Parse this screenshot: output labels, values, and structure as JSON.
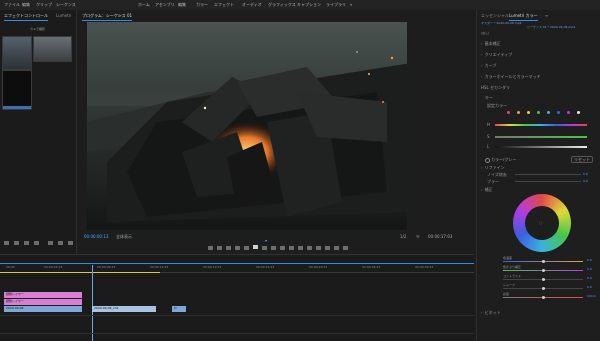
{
  "menubar": {
    "items": [
      "ファイル",
      "編集",
      "クリップ",
      "シーケンス",
      "マーカー",
      "グラフィック",
      "表示",
      "ウィンドウ",
      "ヘルプ",
      "ホーム",
      "アセンブリ",
      "編集",
      "カラー",
      "エフェクト",
      "オーディオ",
      "グラフィックス",
      "キャプション",
      "ライブラリ",
      "»"
    ]
  },
  "left_panel": {
    "tabs": [
      "エフェクトコントロール",
      "Lumetri"
    ],
    "clip_title": "カメラ撮影",
    "thumb_label": "00:00",
    "footer_icons": [
      "list-view-icon",
      "icon-view-icon",
      "freeform-icon",
      "zoom-icon",
      "bin-icon",
      "new-item-icon",
      "trash-icon"
    ]
  },
  "program": {
    "title": "プログラム：シーケンス 01",
    "menu_glyph": "≡",
    "timecode_left": "00:00:00:13",
    "fit": "全体表示",
    "quality": "1/2",
    "timecode_right": "00:00:17:03",
    "playhead_glyph": "▾",
    "wrench_glyph": "⚒",
    "controls": [
      "marker-icon",
      "in-point-icon",
      "out-point-icon",
      "go-to-in-icon",
      "step-back-icon",
      "play-icon",
      "step-forward-icon",
      "go-to-out-icon",
      "insert-icon",
      "overwrite-icon",
      "lift-icon",
      "extract-icon",
      "export-frame-icon",
      "comparison-icon",
      "settings-icon",
      "add-icon"
    ]
  },
  "timeline": {
    "ruler_labels": [
      "00:00",
      "00:00:04:23",
      "00:00:09:23",
      "00:00:14:23",
      "00:00:19:23",
      "00:00:24:23",
      "00:00:29:23",
      "00:00:34:23",
      "00:00:39:23",
      "00:00:44:23"
    ],
    "clips": {
      "adj1": "調整レイヤー",
      "adj2": "調整レイヤー",
      "main": "2020-09-08",
      "main2": "2020-09-08_ch2",
      "small": "fx"
    }
  },
  "lumetri": {
    "tabs": [
      "エッセンシャル",
      "Lumetri カラー",
      "≡"
    ],
    "source": "マスター * 2020-09-08.mp4",
    "source2": "シーケンス 01 * 2020-09-08.mp4",
    "dropdown": "(なし)",
    "sections": [
      "基本補正",
      "クリエイティブ",
      "カーブ",
      "カラーホイールとカラーマッチ",
      "HSL セカンダリ"
    ],
    "key_label": "キー",
    "set_color": "設定カラー",
    "h_label": "H",
    "s_label": "S",
    "l_label": "L",
    "color_gray_label": "カラー/グレー",
    "reset_button": "リセット",
    "refine_label": "リファイン",
    "denoise_label": "ノイズ除去",
    "blur_label": "ブラー",
    "correction_label": "補正",
    "sliders": [
      "色温度",
      "色かぶり補正",
      "コントラスト",
      "シャープ",
      "彩度"
    ],
    "vignette": "ビネット",
    "swatch_colors": [
      "#e04a4a",
      "#e0a43b",
      "#e0d93b",
      "#47c64a",
      "#3bb2e0",
      "#3b5ee0",
      "#b43be0",
      "#e8e8e8"
    ],
    "values": [
      "0.0",
      "0.0",
      "0.0",
      "0.0",
      "100.0"
    ],
    "refine_values": [
      "0.0",
      "0.0"
    ],
    "wheel_label": "○"
  },
  "colors": {
    "accent": "#2d8ceb",
    "clip_pink": "#d87fd4",
    "clip_blue": "#7ea8d8",
    "wheel_ring": "conic"
  }
}
